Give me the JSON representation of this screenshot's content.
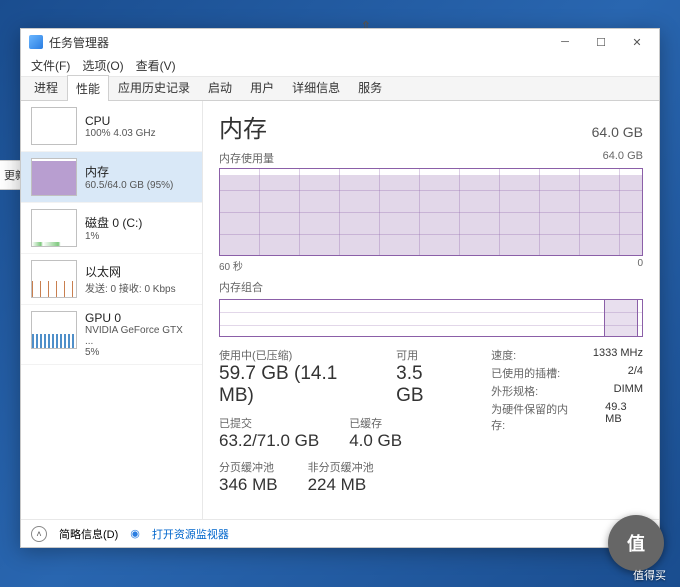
{
  "window": {
    "title": "任务管理器"
  },
  "menu": {
    "file": "文件(F)",
    "options": "选项(O)",
    "view": "查看(V)"
  },
  "tabs": [
    "进程",
    "性能",
    "应用历史记录",
    "启动",
    "用户",
    "详细信息",
    "服务"
  ],
  "active_tab": 1,
  "sidebar": {
    "items": [
      {
        "name": "CPU",
        "sub": "100%  4.03 GHz"
      },
      {
        "name": "内存",
        "sub": "60.5/64.0 GB (95%)"
      },
      {
        "name": "磁盘 0 (C:)",
        "sub": "1%"
      },
      {
        "name": "以太网",
        "sub": "发送: 0  接收: 0 Kbps"
      },
      {
        "name": "GPU 0",
        "sub": "NVIDIA GeForce GTX ...",
        "sub2": "5%"
      }
    ],
    "selected": 1
  },
  "main": {
    "title": "内存",
    "total": "64.0 GB",
    "usage_label": "内存使用量",
    "usage_max": "64.0 GB",
    "axis_left": "60 秒",
    "axis_right": "0",
    "comp_label": "内存组合",
    "stats": {
      "in_use_label": "使用中(已压缩)",
      "in_use": "59.7 GB (14.1 MB)",
      "avail_label": "可用",
      "avail": "3.5 GB",
      "committed_label": "已提交",
      "committed": "63.2/71.0 GB",
      "cached_label": "已缓存",
      "cached": "4.0 GB",
      "paged_label": "分页缓冲池",
      "paged": "346 MB",
      "nonpaged_label": "非分页缓冲池",
      "nonpaged": "224 MB"
    },
    "right": {
      "speed_k": "速度:",
      "speed_v": "1333 MHz",
      "slots_k": "已使用的插槽:",
      "slots_v": "2/4",
      "form_k": "外形规格:",
      "form_v": "DIMM",
      "reserved_k": "为硬件保留的内存:",
      "reserved_v": "49.3 MB"
    }
  },
  "footer": {
    "less": "简略信息(D)",
    "resmon": "打开资源监视器"
  },
  "edge": {
    "update": "更新"
  },
  "watermark": "值得买"
}
